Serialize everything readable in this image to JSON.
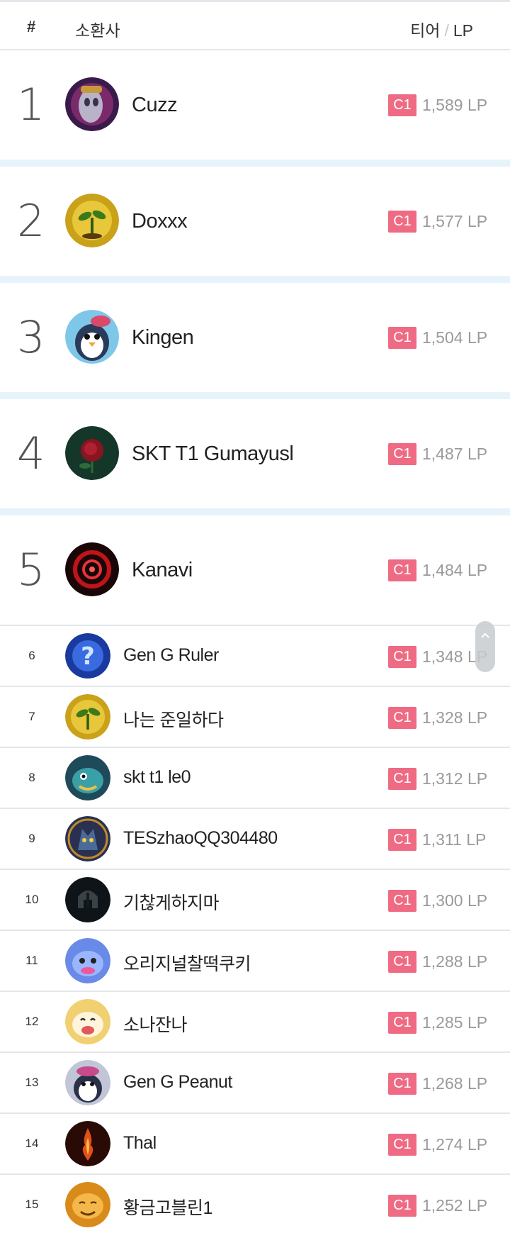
{
  "header": {
    "hash": "#",
    "summoner": "소환사",
    "tier": "티어",
    "slash": "/",
    "lp": "LP"
  },
  "rows": [
    {
      "rank": "1",
      "name": "Cuzz",
      "tier": "C1",
      "lp": "1,589 LP",
      "icon": "masked-champion-icon"
    },
    {
      "rank": "2",
      "name": "Doxxx",
      "tier": "C1",
      "lp": "1,577 LP",
      "icon": "sprout-icon"
    },
    {
      "rank": "3",
      "name": "Kingen",
      "tier": "C1",
      "lp": "1,504 LP",
      "icon": "penguin-icon"
    },
    {
      "rank": "4",
      "name": "SKT T1 Gumayusl",
      "tier": "C1",
      "lp": "1,487 LP",
      "icon": "rose-icon"
    },
    {
      "rank": "5",
      "name": "Kanavi",
      "tier": "C1",
      "lp": "1,484 LP",
      "icon": "red-swirl-icon"
    },
    {
      "rank": "6",
      "name": "Gen G Ruler",
      "tier": "C1",
      "lp": "1,348 LP",
      "icon": "question-mark-icon"
    },
    {
      "rank": "7",
      "name": "나는 준일하다",
      "tier": "C1",
      "lp": "1,328 LP",
      "icon": "sprout-icon"
    },
    {
      "rank": "8",
      "name": "skt t1 le0",
      "tier": "C1",
      "lp": "1,312 LP",
      "icon": "fish-creature-icon"
    },
    {
      "rank": "9",
      "name": "TESzhaoQQ304480",
      "tier": "C1",
      "lp": "1,311 LP",
      "icon": "werewolf-icon"
    },
    {
      "rank": "10",
      "name": "기찮게하지마",
      "tier": "C1",
      "lp": "1,300 LP",
      "icon": "helmet-icon"
    },
    {
      "rank": "11",
      "name": "오리지널찰떡쿠키",
      "tier": "C1",
      "lp": "1,288 LP",
      "icon": "blue-poro-icon"
    },
    {
      "rank": "12",
      "name": "소나잔나",
      "tier": "C1",
      "lp": "1,285 LP",
      "icon": "poro-icon"
    },
    {
      "rank": "13",
      "name": "Gen G Peanut",
      "tier": "C1",
      "lp": "1,268 LP",
      "icon": "penguin-icon"
    },
    {
      "rank": "14",
      "name": "Thal",
      "tier": "C1",
      "lp": "1,274 LP",
      "icon": "flame-icon"
    },
    {
      "rank": "15",
      "name": "황금고블린1",
      "tier": "C1",
      "lp": "1,252 LP",
      "icon": "golden-goblin-icon"
    }
  ],
  "colors": {
    "tier_badge": "#ef6a83",
    "separator": "#e7f3fb",
    "lp_text": "#9a9a9a"
  }
}
